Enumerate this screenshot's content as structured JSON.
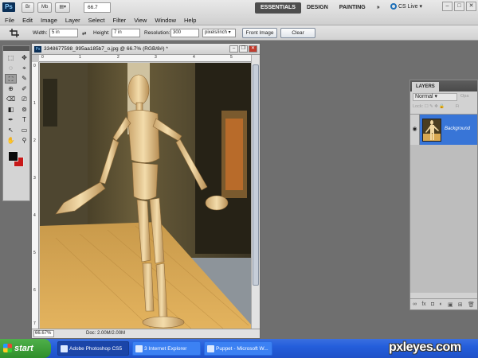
{
  "app": {
    "logo": "Ps",
    "menu": [
      "File",
      "Edit",
      "Image",
      "Layer",
      "Select",
      "Filter",
      "View",
      "Window",
      "Help"
    ],
    "appbar_buttons": [
      "Br",
      "Mb"
    ],
    "zoom": "66.7",
    "workspaces": [
      "ESSENTIALS",
      "DESIGN",
      "PAINTING"
    ],
    "workspace_more": "»",
    "cs_live": "CS Live",
    "window_controls": [
      "–",
      "□",
      "✕"
    ]
  },
  "options": {
    "width_label": "Width:",
    "width_value": "5 in",
    "height_label": "Height:",
    "height_value": "7 in",
    "resolution_label": "Resolution:",
    "resolution_value": "300",
    "resolution_unit": "pixels/inch",
    "front_image": "Front Image",
    "clear": "Clear"
  },
  "tools": [
    "⬚",
    "✥",
    "◌",
    "⌖",
    "⛶",
    "✎",
    "⊕",
    "✐",
    "⌫",
    "⎚",
    "◧",
    "⊚",
    "✒",
    "T",
    "↖",
    "▭",
    "✋",
    "⚲"
  ],
  "document": {
    "title": "3348677598_995aa185b7_o.jpg @ 66.7% (RGB/8#) *",
    "zoom": "66.67%",
    "doc_info": "Doc: 2.00M/2.00M",
    "ruler_top": [
      "0",
      "1",
      "2",
      "3",
      "4",
      "5"
    ],
    "ruler_left": [
      "0",
      "1",
      "2",
      "3",
      "4",
      "5",
      "6",
      "7"
    ]
  },
  "layers": {
    "tab": "LAYERS",
    "blend_mode": "Normal",
    "opacity_label": "Opa",
    "lock_label": "Lock:",
    "fill_label": "Fi",
    "layer_name": "Background",
    "footer_icons": [
      "∞",
      "fx",
      "◘",
      "◐",
      "▣",
      "⊞",
      "🗑"
    ]
  },
  "taskbar": {
    "start": "start",
    "tasks": [
      "Adobe Photoshop CS5",
      "3 Internet Explorer",
      "Puppet - Microsoft W..."
    ]
  },
  "watermark": "pxleyes.com"
}
